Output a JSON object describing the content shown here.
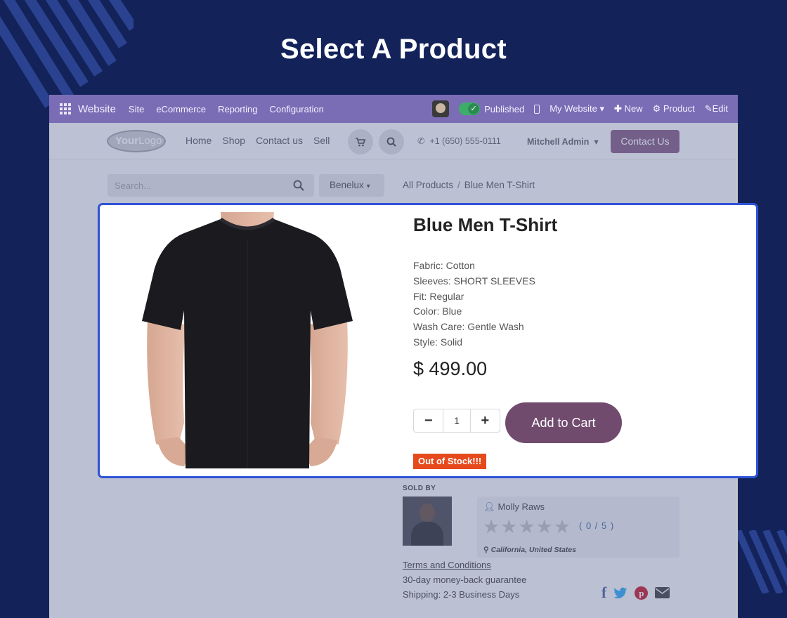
{
  "page_heading": "Select A Product",
  "admin_bar": {
    "brand": "Website",
    "menus": [
      "Site",
      "eCommerce",
      "Reporting",
      "Configuration"
    ],
    "published": "Published",
    "my_website": "My Website",
    "new": "New",
    "product": "Product",
    "edit": "Edit"
  },
  "site_nav": {
    "logo_text_bold": "Your",
    "logo_text_light": "Logo",
    "links": [
      "Home",
      "Shop",
      "Contact us",
      "Sell"
    ],
    "phone": "+1 (650) 555-0111",
    "user": "Mitchell Admin",
    "contact_button": "Contact Us"
  },
  "search": {
    "placeholder": "Search..."
  },
  "region": "Benelux",
  "breadcrumb": {
    "root": "All Products",
    "separator": "/",
    "current": "Blue Men T-Shirt"
  },
  "product": {
    "title": "Blue Men T-Shirt",
    "attributes": [
      "Fabric: Cotton",
      "Sleeves: SHORT SLEEVES",
      "Fit: Regular",
      "Color: Blue",
      "Wash Care: Gentle Wash",
      "Style: Solid"
    ],
    "price": "$ 499.00",
    "quantity": "1",
    "add_to_cart": "Add to Cart",
    "stock_badge": "Out of Stock!!!"
  },
  "seller": {
    "sold_by": "SOLD BY",
    "name": "Molly Raws",
    "rating": "( 0 / 5 )",
    "rating_value": 0,
    "location": "California, United States"
  },
  "footer_links": {
    "terms": "Terms and Conditions",
    "guarantee": "30-day money-back guarantee",
    "shipping": "Shipping: 2-3 Business Days"
  },
  "colors": {
    "background": "#13235a",
    "admin_bar": "#7a6db5",
    "highlight_border": "#2f54d6",
    "primary_button": "#714b6e",
    "stock_badge": "#e64a1c"
  },
  "icons": [
    "apps-grid-icon",
    "published-check-icon",
    "mobile-icon",
    "plus-icon",
    "gear-icon",
    "pencil-icon",
    "cart-icon",
    "search-icon",
    "phone-icon",
    "caret-down-icon",
    "person-icon",
    "star-icon",
    "map-marker-icon",
    "facebook-icon",
    "twitter-icon",
    "pinterest-icon",
    "envelope-icon"
  ]
}
